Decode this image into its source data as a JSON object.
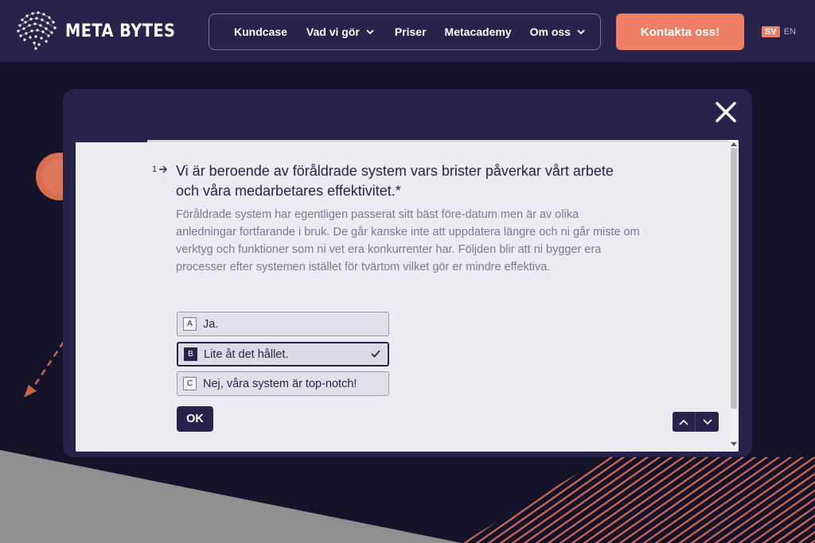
{
  "brand": {
    "name": "META BYTES",
    "logo_icon": "brain-dots-icon"
  },
  "nav": {
    "items": [
      {
        "label": "Kundcase",
        "has_dropdown": false
      },
      {
        "label": "Vad vi gör",
        "has_dropdown": true
      },
      {
        "label": "Priser",
        "has_dropdown": false
      },
      {
        "label": "Metacademy",
        "has_dropdown": false
      },
      {
        "label": "Om oss",
        "has_dropdown": true
      }
    ],
    "chevron_icon": "chevron-down-icon"
  },
  "contact_button": {
    "label": "Kontakta oss!"
  },
  "language": {
    "active": "SV",
    "other": "EN"
  },
  "modal": {
    "close_icon": "close-icon",
    "progress_fraction": 0.11,
    "question": {
      "number": "1",
      "title": "Vi är beroende av föråldrade system vars brister påverkar vårt arbete och våra medarbetares effektivitet.*",
      "description": "Föråldrade system har egentligen passerat sitt bäst före-datum men är av olika anledningar fortfarande i bruk. De går kanske inte att uppdatera längre och ni går miste om verktyg och funktioner som ni vet era konkurrenter har. Följden blir att ni bygger era processer efter systemen istället för tvärtom vilket gör er mindre effektiva.",
      "choices": [
        {
          "key": "A",
          "label": "Ja.",
          "selected": false
        },
        {
          "key": "B",
          "label": "Lite åt det hållet.",
          "selected": true
        },
        {
          "key": "C",
          "label": "Nej, våra system är top-notch!",
          "selected": false
        }
      ]
    },
    "ok_label": "OK"
  },
  "colors": {
    "header_bg": "#27234a",
    "page_bg": "#15132a",
    "accent": "#ef7f64",
    "panel_bg": "#ecebf1",
    "text_dark": "#27234a"
  }
}
